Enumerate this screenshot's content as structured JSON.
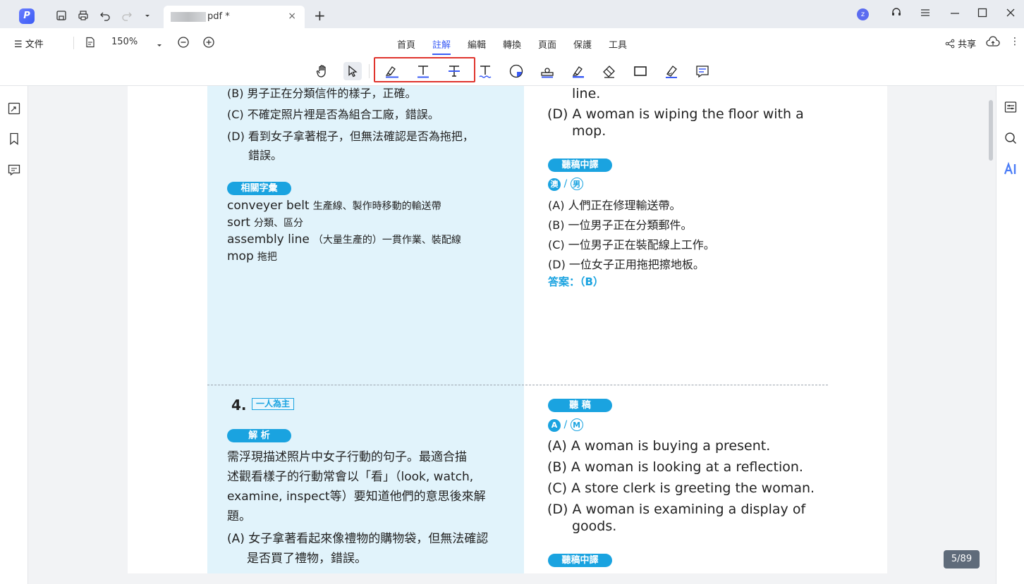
{
  "titlebar": {
    "app_logo": "P",
    "tab_name": "pdf *",
    "tab_close": "×",
    "tab_add": "+",
    "avatar_letter": "z"
  },
  "menubar": {
    "file_label": "文件",
    "zoom_value": "150%",
    "nav_tabs": [
      "首頁",
      "註解",
      "編輯",
      "轉換",
      "頁面",
      "保護",
      "工具"
    ],
    "active_tab": "註解",
    "share_label": "共享"
  },
  "toolbar": {
    "tools": [
      "hand-icon",
      "select-icon",
      "highlight-icon",
      "underline-icon",
      "strikethrough-icon",
      "squiggly-icon",
      "sticker-icon",
      "stamp-icon",
      "area-highlight-icon",
      "eraser-icon",
      "rectangle-icon",
      "pen-icon",
      "comment-icon"
    ]
  },
  "colors": {
    "accent": "#3b5cf5",
    "pill": "#1aa3e0",
    "highlight_box": "#e0342d",
    "blue_column": "#e1f3fb"
  },
  "left_col": {
    "b_line": "(B) 男子正在分類信件的樣子，正確。",
    "c_line": "(C) 不確定照片裡是否為組合工廠，錯誤。",
    "d_line1": "(D) 看到女子拿著棍子，但無法確認是否為拖把，",
    "d_line2": "錯誤。",
    "vocab_pill": "相關字彙",
    "vocab": [
      {
        "en": "conveyer belt",
        "zh": "生產線、製作時移動的輸送帶"
      },
      {
        "en": "sort",
        "zh": "分類、區分"
      },
      {
        "en": "assembly line",
        "zh": "（大量生產的）一貫作業、裝配線"
      },
      {
        "en": "mop",
        "zh": "拖把"
      }
    ]
  },
  "right_col": {
    "line_top": "line.",
    "d_en1": "(D) A woman is wiping the floor with a",
    "d_en2": "mop.",
    "transcript_pill": "聽稿中譯",
    "speaker1": "澳",
    "speaker_sep": "/",
    "speaker2": "男",
    "zh_options": [
      "(A) 人們正在修理輸送帶。",
      "(B) 一位男子正在分類郵件。",
      "(C) 一位男子正在裝配線上工作。",
      "(D) 一位女子正用拖把擦地板。"
    ],
    "answer": "答案：（B）"
  },
  "q4": {
    "number": "4.",
    "tag": "一人為主",
    "analysis_pill": "解 析",
    "analysis": [
      "需浮現描述照片中女子行動的句子。最適合描",
      "述觀看樣子的行動常會以「看」（look, watch,",
      "examine, inspect等）要知道他們的意思後來解",
      "題。"
    ],
    "a_line1": "(A) 女子拿著看起來像禮物的購物袋，但無法確認",
    "a_line2": "是否買了禮物，錯誤。",
    "listen_pill": "聽 稿",
    "speaker1": "A",
    "speaker_sep": "/",
    "speaker2": "M",
    "options": [
      "(A) A woman is buying a present.",
      "(B) A woman is looking at a reflection.",
      "(C) A store clerk is greeting the woman.",
      "(D) A woman is examining a display of"
    ],
    "d_cont": "goods.",
    "transcript_pill2": "聽稿中譯"
  },
  "page_counter": "5/89"
}
